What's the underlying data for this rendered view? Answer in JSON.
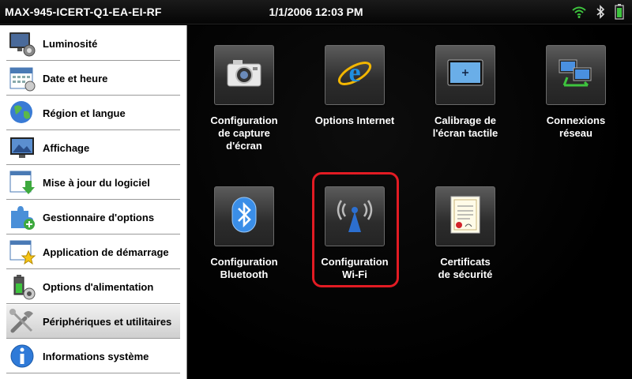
{
  "status": {
    "device_name": "MAX-945-ICERT-Q1-EA-EI-RF",
    "datetime": "1/1/2006 12:03 PM",
    "icons": [
      "wifi-icon",
      "bluetooth-icon",
      "battery-icon"
    ]
  },
  "sidebar": {
    "items": [
      {
        "label": "Luminosité",
        "icon": "brightness-icon"
      },
      {
        "label": "Date et heure",
        "icon": "calendar-icon"
      },
      {
        "label": "Région et langue",
        "icon": "globe-icon"
      },
      {
        "label": "Affichage",
        "icon": "display-icon"
      },
      {
        "label": "Mise à jour du logiciel",
        "icon": "download-icon"
      },
      {
        "label": "Gestionnaire d'options",
        "icon": "puzzle-icon"
      },
      {
        "label": "Application de démarrage",
        "icon": "star-window-icon"
      },
      {
        "label": "Options d'alimentation",
        "icon": "power-icon"
      },
      {
        "label": "Périphériques et utilitaires",
        "icon": "tools-icon",
        "active": true
      },
      {
        "label": "Informations système",
        "icon": "info-icon"
      }
    ]
  },
  "main": {
    "tiles": [
      {
        "label_lines": [
          "Configuration",
          "de capture",
          "d'écran"
        ],
        "icon": "camera-icon"
      },
      {
        "label_lines": [
          "Options Internet"
        ],
        "icon": "internet-explorer-icon"
      },
      {
        "label_lines": [
          "Calibrage de",
          "l'écran tactile"
        ],
        "icon": "touch-calibration-icon"
      },
      {
        "label_lines": [
          "Connexions",
          "réseau"
        ],
        "icon": "network-icon"
      },
      {
        "label_lines": [
          "Configuration",
          "Bluetooth"
        ],
        "icon": "bluetooth-icon"
      },
      {
        "label_lines": [
          "Configuration",
          "Wi-Fi"
        ],
        "icon": "wifi-antenna-icon",
        "highlighted": true
      },
      {
        "label_lines": [
          "Certificats",
          "de sécurité"
        ],
        "icon": "certificate-icon"
      }
    ]
  },
  "colors": {
    "highlight": "#e21b23",
    "wifi_green": "#3ec43e"
  }
}
